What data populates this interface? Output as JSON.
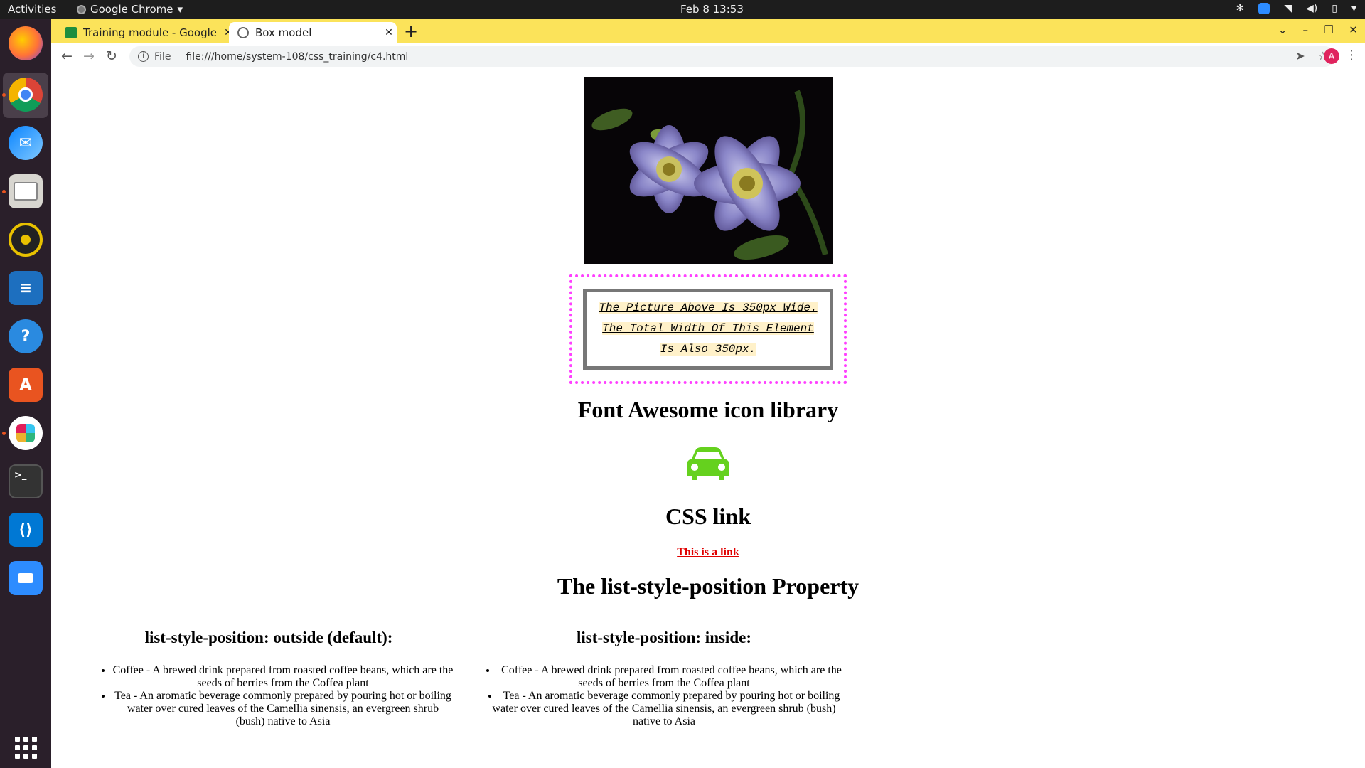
{
  "topbar": {
    "activities": "Activities",
    "app_name": "Google Chrome",
    "clock": "Feb 8  13:53"
  },
  "dock": {
    "items": [
      "firefox-icon",
      "chrome-icon",
      "thunderbird-icon",
      "files-icon",
      "rhythmbox-icon",
      "writer-icon",
      "help-icon",
      "software-icon",
      "slack-icon",
      "terminal-icon",
      "vscode-icon",
      "zoom-icon",
      "show-apps-icon"
    ]
  },
  "browser": {
    "tabs": [
      {
        "title": "Training module - Google",
        "active": false
      },
      {
        "title": "Box model",
        "active": true
      }
    ],
    "omnibox": {
      "scheme_label": "File",
      "url": "file:///home/system-108/css_training/c4.html"
    },
    "avatar_letter": "A"
  },
  "page": {
    "box_text": [
      "The Picture Above Is 350px Wide.",
      "The Total Width Of This Element",
      "Is Also 350px."
    ],
    "heading_icons": "Font Awesome icon library",
    "icon": "car-icon",
    "icon_color": "#65d11e",
    "heading_link": "CSS link",
    "link_text": "This is a link",
    "heading_list": "The list-style-position Property",
    "col_outside": {
      "heading": "list-style-position: outside (default):",
      "items": [
        "Coffee - A brewed drink prepared from roasted coffee beans, which are the seeds of berries from the Coffea plant",
        "Tea - An aromatic beverage commonly prepared by pouring hot or boiling water over cured leaves of the Camellia sinensis, an evergreen shrub (bush) native to Asia"
      ]
    },
    "col_inside": {
      "heading": "list-style-position: inside:",
      "items": [
        "Coffee - A brewed drink prepared from roasted coffee beans, which are the seeds of berries from the Coffea plant",
        "Tea - An aromatic beverage commonly prepared by pouring hot or boiling water over cured leaves of the Camellia sinensis, an evergreen shrub (bush) native to Asia"
      ]
    }
  }
}
